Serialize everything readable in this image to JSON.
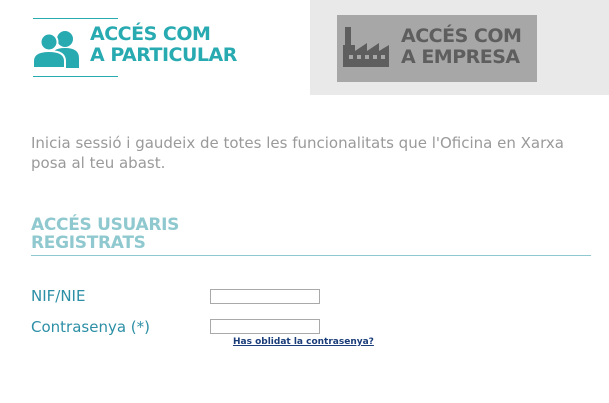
{
  "tabs": {
    "particular": {
      "line1": "ACCÉS COM",
      "line2": "A PARTICULAR",
      "icon": "people-icon",
      "color": "#28aab1"
    },
    "empresa": {
      "line1": "ACCÉS COM",
      "line2": "A EMPRESA",
      "icon": "factory-icon",
      "color": "#5e5e5e"
    }
  },
  "intro": "Inicia sessió i gaudeix de totes les funcionalitats que l'Oficina en Xarxa posa al teu abast.",
  "section": {
    "line1": "ACCÉS USUARIS",
    "line2": "REGISTRATS"
  },
  "form": {
    "nif_label": "NIF/NIE",
    "nif_value": "",
    "password_label": "Contrasenya (*)",
    "password_value": "",
    "forgot_link": "Has oblidat la contrasenya?"
  }
}
